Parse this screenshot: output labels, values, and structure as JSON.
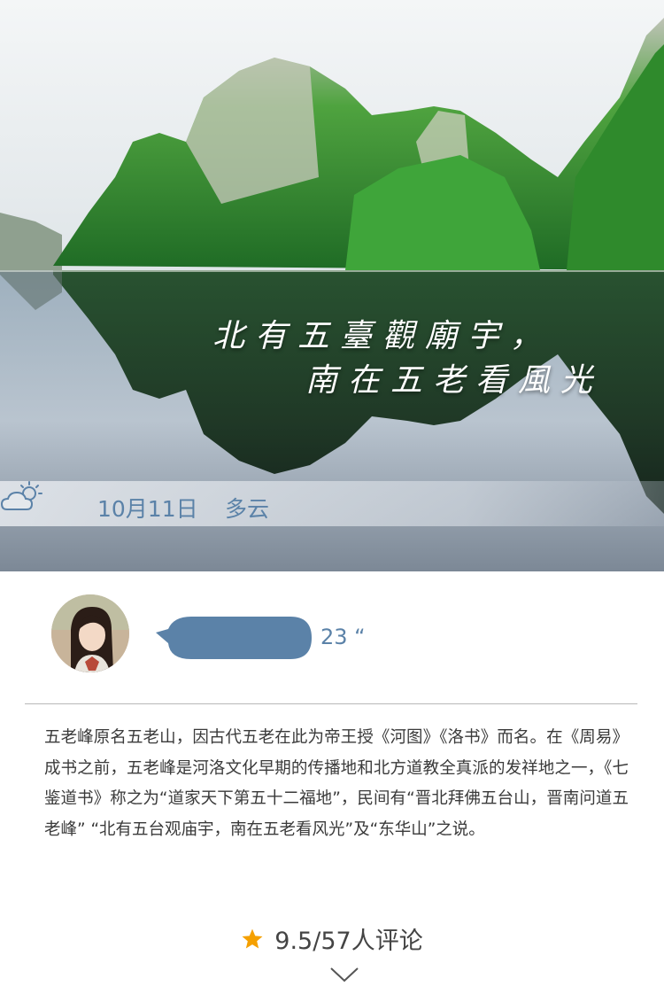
{
  "hero": {
    "poem_line1": "北有五臺觀廟宇，",
    "poem_line2": "南在五老看風光"
  },
  "weather": {
    "icon": "partly-cloudy-icon",
    "date": "10月11日",
    "condition": "多云"
  },
  "audio": {
    "duration": "23 “"
  },
  "description": "五老峰原名五老山，因古代五老在此为帝王授《河图》《洛书》而名。在《周易》成书之前，五老峰是河洛文化早期的传播地和北方道教全真派的发祥地之一，《七鉴道书》称之为“道家天下第五十二福地”，民间有“晋北拜佛五台山，晋南问道五老峰” “北有五台观庙宇，南在五老看风光”及“东华山”之说。",
  "rating": {
    "icon": "star-icon",
    "text": "9.5/57人评论"
  },
  "colors": {
    "accent": "#5b82a8",
    "star": "#f5a000"
  }
}
